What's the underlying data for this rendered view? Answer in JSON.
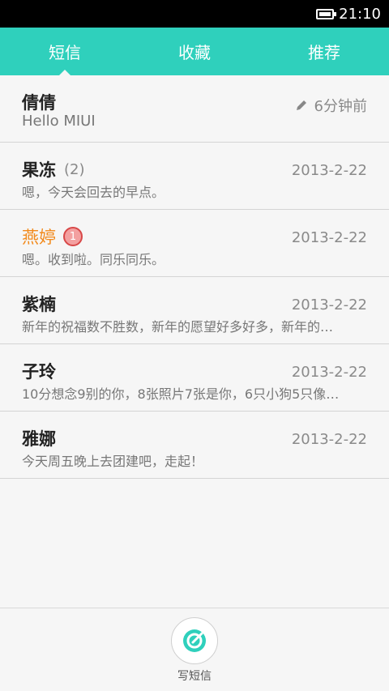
{
  "status_bar": {
    "time": "21:10"
  },
  "tabs": [
    {
      "label": "短信",
      "active": true
    },
    {
      "label": "收藏",
      "active": false
    },
    {
      "label": "推荐",
      "active": false
    }
  ],
  "threads": [
    {
      "name": "倩倩",
      "count": "",
      "unread_badge": "",
      "date": "6分钟前",
      "preview": "Hello MIUI",
      "draft": true
    },
    {
      "name": "果冻",
      "count": "(2)",
      "unread_badge": "",
      "date": "2013-2-22",
      "preview": "嗯，今天会回去的早点。"
    },
    {
      "name": "燕婷",
      "count": "",
      "unread_badge": "1",
      "date": "2013-2-22",
      "preview": "嗯。收到啦。同乐同乐。"
    },
    {
      "name": "紫楠",
      "count": "",
      "unread_badge": "",
      "date": "2013-2-22",
      "preview": "新年的祝福数不胜数，新年的愿望好多好多，新年的…"
    },
    {
      "name": "子玲",
      "count": "",
      "unread_badge": "",
      "date": "2013-2-22",
      "preview": "10分想念9别的你，8张照片7张是你，6只小狗5只像…"
    },
    {
      "name": "雅娜",
      "count": "",
      "unread_badge": "",
      "date": "2013-2-22",
      "preview": "今天周五晚上去团建吧，走起！"
    }
  ],
  "compose": {
    "label": "写短信",
    "icon": "compose-icon"
  },
  "colors": {
    "accent": "#2fd0bc",
    "unread_name": "#f28a1c",
    "badge": "#d84848"
  }
}
